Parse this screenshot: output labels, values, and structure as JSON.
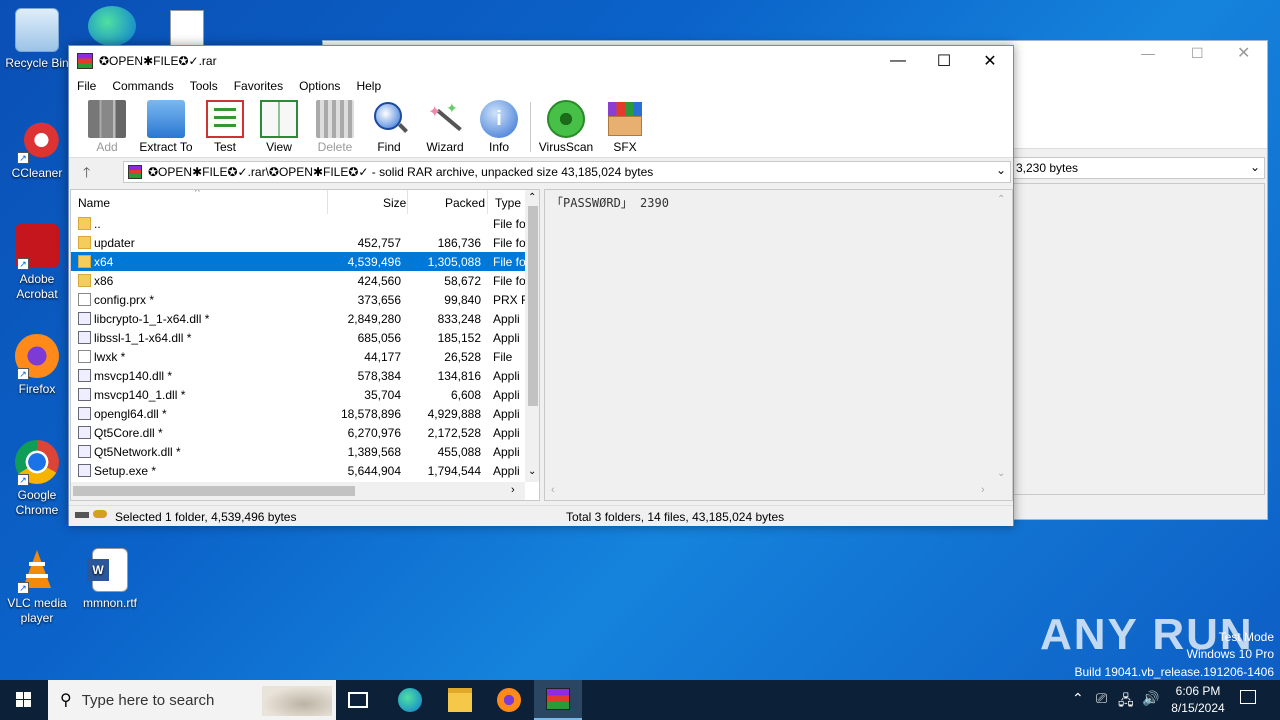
{
  "desktop": {
    "icons": [
      {
        "label": "Recycle Bin"
      },
      {
        "label": "CCleaner"
      },
      {
        "label": "Adobe Acrobat"
      },
      {
        "label": "Firefox"
      },
      {
        "label": "Google Chrome"
      },
      {
        "label": "VLC media player"
      },
      {
        "label": "mmnon.rtf"
      }
    ]
  },
  "bg_window": {
    "addr_text": "3,230 bytes"
  },
  "window": {
    "title": "✪OPEN✱FILE✪✓.rar",
    "menu": [
      "File",
      "Commands",
      "Tools",
      "Favorites",
      "Options",
      "Help"
    ],
    "toolbar": [
      "Add",
      "Extract To",
      "Test",
      "View",
      "Delete",
      "Find",
      "Wizard",
      "Info",
      "VirusScan",
      "SFX"
    ],
    "address": "✪OPEN✱FILE✪✓.rar\\✪OPEN✱FILE✪✓ - solid RAR archive, unpacked size 43,185,024 bytes",
    "columns": {
      "name": "Name",
      "size": "Size",
      "packed": "Packed",
      "type": "Type"
    },
    "rows": [
      {
        "name": "..",
        "size": "",
        "packed": "",
        "type": "File fo",
        "kind": "folder"
      },
      {
        "name": "updater",
        "size": "452,757",
        "packed": "186,736",
        "type": "File fo",
        "kind": "folder"
      },
      {
        "name": "x64",
        "size": "4,539,496",
        "packed": "1,305,088",
        "type": "File fo",
        "kind": "folder"
      },
      {
        "name": "x86",
        "size": "424,560",
        "packed": "58,672",
        "type": "File fo",
        "kind": "folder"
      },
      {
        "name": "config.prx *",
        "size": "373,656",
        "packed": "99,840",
        "type": "PRX F",
        "kind": "file"
      },
      {
        "name": "libcrypto-1_1-x64.dll *",
        "size": "2,849,280",
        "packed": "833,248",
        "type": "Appli",
        "kind": "dll"
      },
      {
        "name": "libssl-1_1-x64.dll *",
        "size": "685,056",
        "packed": "185,152",
        "type": "Appli",
        "kind": "dll"
      },
      {
        "name": "lwxk *",
        "size": "44,177",
        "packed": "26,528",
        "type": "File",
        "kind": "file"
      },
      {
        "name": "msvcp140.dll *",
        "size": "578,384",
        "packed": "134,816",
        "type": "Appli",
        "kind": "dll"
      },
      {
        "name": "msvcp140_1.dll *",
        "size": "35,704",
        "packed": "6,608",
        "type": "Appli",
        "kind": "dll"
      },
      {
        "name": "opengl64.dll *",
        "size": "18,578,896",
        "packed": "4,929,888",
        "type": "Appli",
        "kind": "dll"
      },
      {
        "name": "Qt5Core.dll *",
        "size": "6,270,976",
        "packed": "2,172,528",
        "type": "Appli",
        "kind": "dll"
      },
      {
        "name": "Qt5Network.dll *",
        "size": "1,389,568",
        "packed": "455,088",
        "type": "Appli",
        "kind": "dll"
      },
      {
        "name": "Setup.exe *",
        "size": "5,644,904",
        "packed": "1,794,544",
        "type": "Appli",
        "kind": "exe"
      }
    ],
    "selected_row": 2,
    "preview_text": "「PASSWØRD」 2390",
    "status_left": "Selected 1 folder, 4,539,496 bytes",
    "status_right": "Total 3 folders, 14 files, 43,185,024 bytes"
  },
  "taskbar": {
    "search_placeholder": "Type here to search",
    "time": "6:06 PM",
    "date": "8/15/2024"
  },
  "watermark": {
    "brand": "ANY RUN",
    "line1": "Test Mode",
    "line2": "Windows 10 Pro",
    "line3": "Build 19041.vb_release.191206-1406"
  },
  "colors": {
    "selection": "#0078d7",
    "taskbar": "#0c2138"
  }
}
